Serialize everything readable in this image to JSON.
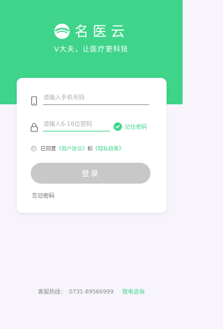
{
  "brand": {
    "name": "名医云",
    "slogan": "V大夫，让医疗更科技",
    "logo_icon": "leaf-bowl-logo"
  },
  "form": {
    "phone_placeholder": "请输入手机号码",
    "phone_icon": "phone-icon",
    "password_placeholder": "请输入6-16位密码",
    "password_icon": "lock-icon",
    "remember_label": "记住密码",
    "remember_checked": true,
    "agree_prefix": "已同意",
    "user_agreement": "《用户协议》",
    "agree_and": "和",
    "privacy_policy": "《隐私政策》",
    "agree_checked": false,
    "login_label": "登录",
    "forgot_label": "忘记密码"
  },
  "footer": {
    "hotline_label": "客服热线：",
    "hotline_number": "0731-89566999",
    "call_label": "致电咨询"
  },
  "colors": {
    "accent": "#3ed48a",
    "background": "#f7f5fb",
    "button_disabled": "#c8c8c8"
  }
}
